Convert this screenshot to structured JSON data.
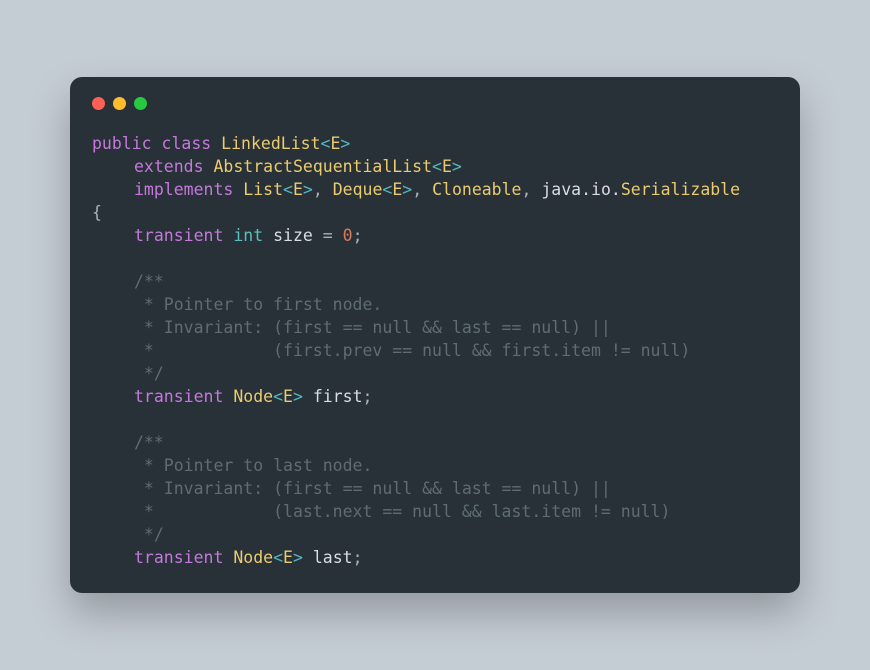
{
  "line1": {
    "public": "public",
    "class": "class",
    "name": "LinkedList",
    "open": "<",
    "E": "E",
    "close": ">"
  },
  "line2": {
    "extends": "extends",
    "name": "AbstractSequentialList",
    "open": "<",
    "E": "E",
    "close": ">"
  },
  "line3": {
    "implements": "implements",
    "List": "List",
    "o1": "<",
    "E1": "E",
    "c1": ">",
    "comma1": ", ",
    "Deque": "Deque",
    "o2": "<",
    "E2": "E",
    "c2": ">",
    "comma2": ", ",
    "Cloneable": "Cloneable",
    "comma3": ", ",
    "pkg": "java.io.",
    "Serializable": "Serializable"
  },
  "brace_open": "{",
  "line5": {
    "transient": "transient",
    "int": "int",
    "size": "size",
    "eq": " = ",
    "zero": "0",
    "semi": ";"
  },
  "c1": "/**",
  "c2": " * Pointer to first node.",
  "c3": " * Invariant: (first == null && last == null) ||",
  "c4": " *            (first.prev == null && first.item != null)",
  "c5": " */",
  "line11": {
    "transient": "transient",
    "Node": "Node",
    "open": "<",
    "E": "E",
    "close": ">",
    "sp": " ",
    "first": "first",
    "semi": ";"
  },
  "d1": "/**",
  "d2": " * Pointer to last node.",
  "d3": " * Invariant: (first == null && last == null) ||",
  "d4": " *            (last.next == null && last.item != null)",
  "d5": " */",
  "line17": {
    "transient": "transient",
    "Node": "Node",
    "open": "<",
    "E": "E",
    "close": ">",
    "sp": " ",
    "last": "last",
    "semi": ";"
  }
}
